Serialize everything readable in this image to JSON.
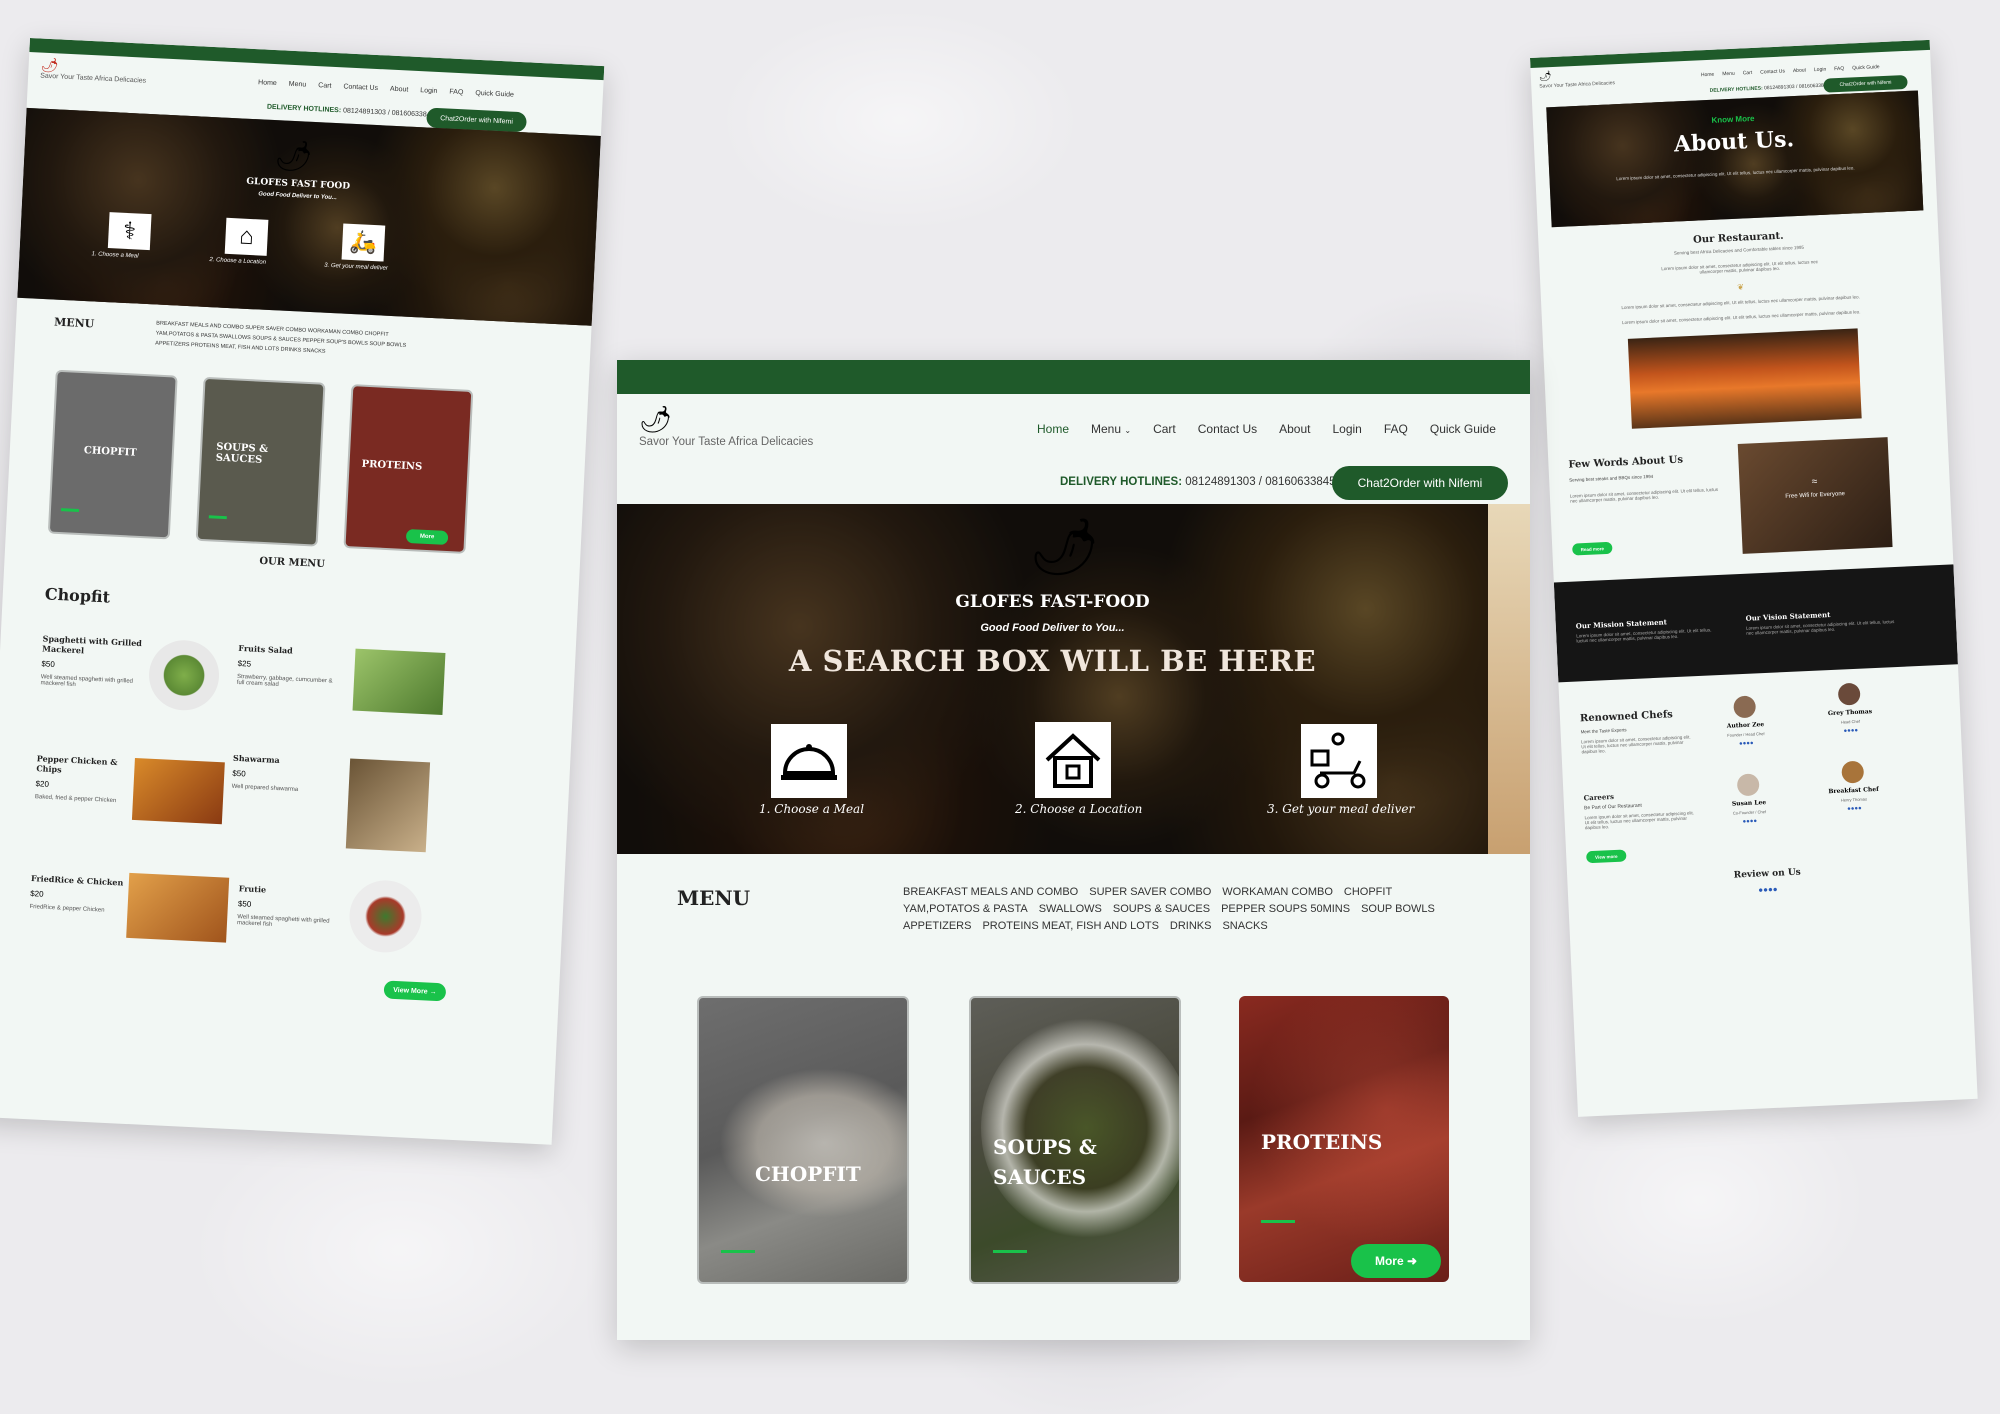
{
  "brand": {
    "tagline": "Savor Your Taste Africa Delicacies",
    "name": "GLOFES FAST-FOOD",
    "slogan": "Good Food Deliver to You..."
  },
  "nav": {
    "items": [
      "Home",
      "Menu",
      "Cart",
      "Contact Us",
      "About",
      "Login",
      "FAQ",
      "Quick Guide"
    ]
  },
  "hotline": {
    "label": "DELIVERY HOTLINES:",
    "numbers": "08124891303 / 08160633845"
  },
  "chat_button": "Chat2Order with Nifemi",
  "hero": {
    "search_placeholder": "A SEARCH BOX WILL BE HERE",
    "steps": [
      "1. Choose a Meal",
      "2. Choose a Location",
      "3. Get your meal deliver"
    ]
  },
  "menu_section": {
    "title": "MENU",
    "links_row1": [
      "BREAKFAST MEALS AND COMBO",
      "SUPER SAVER COMBO",
      "WORKAMAN COMBO",
      "CHOPFIT"
    ],
    "links_row2": [
      "YAM,POTATOS & PASTA",
      "SWALLOWS",
      "SOUPS & SAUCES",
      "PEPPER SOUPS 50MINS",
      "SOUP BOWLS"
    ],
    "links_row3": [
      "APPETIZERS",
      "PROTEINS MEAT, FISH AND LOTS",
      "DRINKS",
      "SNACKS"
    ],
    "cards": [
      "CHOPFIT",
      "SOUPS & SAUCES",
      "PROTEINS"
    ],
    "more_button": "More"
  },
  "left_page": {
    "hero_title": "GLOFES FAST FOOD",
    "steps": [
      "1. Choose a Meal",
      "2. Choose a Location",
      "3. Get your meal deliver"
    ],
    "menu_links_row1": [
      "BREAKFAST MEALS AND COMBO",
      "SUPER SAVER COMBO",
      "WORKAMAN COMBO",
      "CHOPFIT"
    ],
    "menu_links_row2": [
      "YAM,POTATOS & PASTA",
      "SWALLOWS",
      "SOUPS & SAUCES",
      "PEPPER SOUP'S BOWLS",
      "SOUP BOWLS"
    ],
    "menu_links_row3": [
      "APPETIZERS",
      "PROTEINS MEAT, FISH AND LOTS",
      "DRINKS",
      "SNACKS"
    ],
    "cards": [
      "CHOPFIT",
      "SOUPS & SAUCES",
      "PROTEINS"
    ],
    "our_menu": "OUR MENU",
    "category": "Chopfit",
    "items": [
      {
        "name": "Spaghetti with Grilled Mackerel",
        "price": "$50",
        "desc": "Well steamed spaghetti with grilled mackerel fish"
      },
      {
        "name": "Fruits Salad",
        "price": "$25",
        "desc": "Strawberry, gabbage, cumcumber & full cream salad"
      },
      {
        "name": "Pepper Chicken & Chips",
        "price": "$20",
        "desc": "Baked, fried & pepper Chicken"
      },
      {
        "name": "Shawarma",
        "price": "$50",
        "desc": "Well prepared shawarma"
      },
      {
        "name": "FriedRice & Chicken",
        "price": "$20",
        "desc": "FriedRice & pepper Chicken"
      },
      {
        "name": "Frutie",
        "price": "$50",
        "desc": "Well steamed spaghetti with grilled mackerel fish"
      }
    ],
    "view_more": "View More"
  },
  "right_page": {
    "kicker": "Know More",
    "title": "About Us.",
    "hero_text": "Lorem ipsum dolor sit amet, consectetur adipiscing elit. Ut elit tellus, luctus nec ullamcorper mattis, pulvinar dapibus leo.",
    "our_restaurant": "Our Restaurant.",
    "restaurant_sub": "Serving best Africa Delicacies and Comfortable tables since 1995",
    "lorem": "Lorem ipsum dolor sit amet, consectetur adipiscing elit. Ut elit tellus, luctus nec ullamcorper mattis, pulvinar dapibus leo.",
    "few_words": "Few Words About Us",
    "few_words_sub": "Serving best steaks and BBQs since 1994",
    "wifi": "Free Wifi for Everyone",
    "mission": "Our Mission Statement",
    "vision": "Our Vision Statement",
    "chefs_title": "Renowned Chefs",
    "chefs_sub": "Meet the Taste Experts",
    "chefs": [
      {
        "name": "Author Zee",
        "role": "Founder / Head Chef"
      },
      {
        "name": "Grey Thomas",
        "role": "Head Chef"
      },
      {
        "name": "Susan Lee",
        "role": "Co-Founder / Chef"
      },
      {
        "name": "Breakfast Chef",
        "role": "Henry Thomas"
      }
    ],
    "careers": "Careers",
    "careers_sub": "Be Part of Our Restaurant",
    "read_more": "Read more",
    "view_more": "View more",
    "review": "Review on Us"
  },
  "colors": {
    "brand_green": "#1f5a2a",
    "accent_green": "#19c24a",
    "page_bg": "#f2f7f4"
  }
}
